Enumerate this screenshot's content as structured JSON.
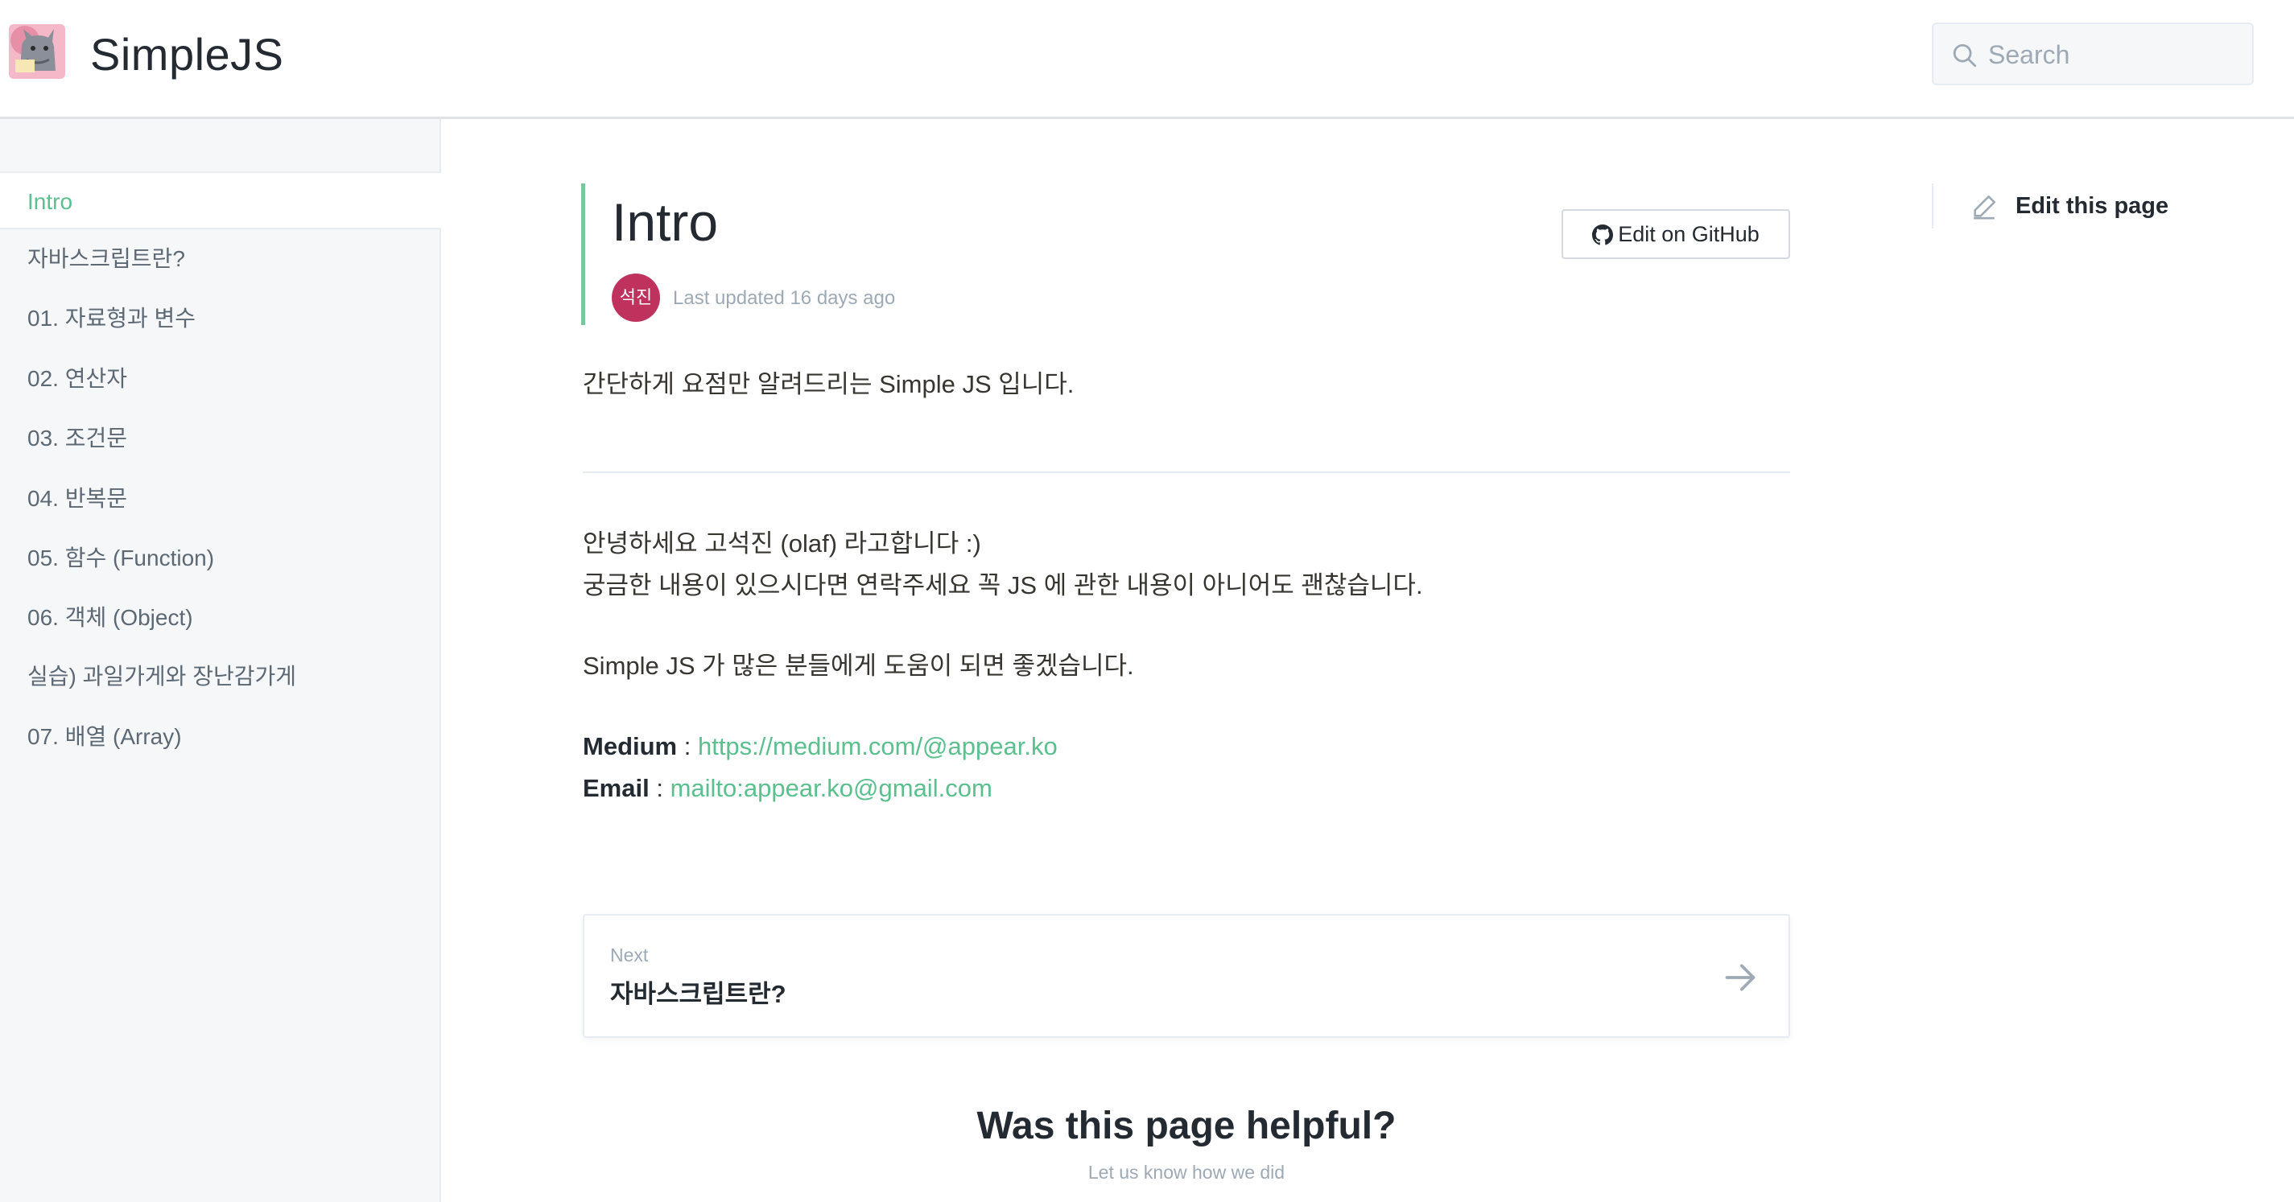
{
  "header": {
    "site_title": "SimpleJS",
    "search": {
      "placeholder": "Search"
    }
  },
  "sidebar": {
    "items": [
      {
        "label": "Intro",
        "active": true
      },
      {
        "label": "자바스크립트란?"
      },
      {
        "label": "01. 자료형과 변수"
      },
      {
        "label": "02. 연산자"
      },
      {
        "label": "03. 조건문"
      },
      {
        "label": "04. 반복문"
      },
      {
        "label": "05. 함수 (Function)"
      },
      {
        "label": "06. 객체 (Object)"
      },
      {
        "label": "실습) 과일가게와 장난감가게"
      },
      {
        "label": "07. 배열 (Array)"
      }
    ]
  },
  "page": {
    "title": "Intro",
    "author_initials": "석진",
    "last_updated": "Last updated 16 days ago",
    "github_button": "Edit on GitHub",
    "edit_this_page": "Edit this page",
    "intro_line": "간단하게 요점만 알려드리는 Simple JS 입니다.",
    "paragraph_1": "안녕하세요 고석진 (olaf) 라고합니다 :)",
    "paragraph_2": "궁금한 내용이 있으시다면 연락주세요 꼭 JS 에 관한 내용이 아니어도 괜찮습니다.",
    "paragraph_3": "Simple JS 가 많은 분들에게 도움이 되면 좋겠습니다.",
    "medium_label": "Medium",
    "medium_link": "https://medium.com/@appear.ko",
    "email_label": "Email",
    "email_link": "mailto:appear.ko@gmail.com",
    "separator": " : "
  },
  "next": {
    "label": "Next",
    "title": "자바스크립트란?"
  },
  "feedback": {
    "title": "Was this page helpful?",
    "subtitle": "Let us know how we did"
  },
  "colors": {
    "accent": "#5bbf8e",
    "avatar": "#c0325e",
    "sidebar_bg": "#f5f7f9"
  }
}
